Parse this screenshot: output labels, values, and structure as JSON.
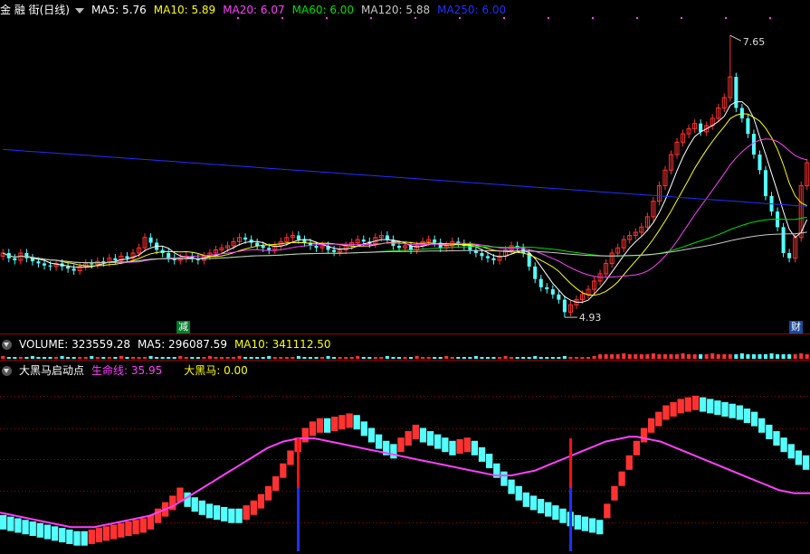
{
  "main_header": {
    "title": "金 融 街(日线)",
    "ma5": "MA5: 5.76",
    "ma10": "MA10: 5.89",
    "ma20": "MA20: 6.07",
    "ma60": "MA60: 6.00",
    "ma120": "MA120: 5.88",
    "ma250": "MA250: 6.00"
  },
  "volume_header": {
    "volume": "VOLUME: 323559.28",
    "ma5": "MA5: 296087.59",
    "ma10": "MA10: 341112.50"
  },
  "indicator_header": {
    "name": "大黑马启动点",
    "line1": "生命线: 35.95",
    "line2": "大黑马: 0.00"
  },
  "colors": {
    "up": "#ff3232",
    "down": "#54ffff",
    "ma5": "#ffffff",
    "ma10": "#ffff00",
    "ma20": "#ff40ff",
    "ma60": "#00e000",
    "ma120": "#c8c8c8",
    "ma250": "#2030ff",
    "life_line": "#ff40ff",
    "grid": "#a00000"
  },
  "marker_labels": {
    "high": "7.65",
    "low": "4.93",
    "tag_jian": "减",
    "tag_cai": "财"
  },
  "chart_data": [
    {
      "type": "candlestick",
      "name": "price",
      "high": 7.65,
      "low": 4.93,
      "ylim": [
        4.8,
        7.8
      ],
      "ma_values": {
        "MA5": 5.76,
        "MA10": 5.89,
        "MA20": 6.07,
        "MA60": 6.0,
        "MA120": 5.88,
        "MA250": 6.0
      },
      "closes": [
        5.55,
        5.5,
        5.48,
        5.55,
        5.5,
        5.47,
        5.45,
        5.43,
        5.42,
        5.45,
        5.42,
        5.4,
        5.38,
        5.42,
        5.45,
        5.44,
        5.47,
        5.46,
        5.5,
        5.48,
        5.52,
        5.5,
        5.55,
        5.6,
        5.7,
        5.65,
        5.58,
        5.55,
        5.5,
        5.48,
        5.5,
        5.52,
        5.5,
        5.48,
        5.52,
        5.55,
        5.58,
        5.6,
        5.62,
        5.66,
        5.7,
        5.68,
        5.65,
        5.62,
        5.6,
        5.58,
        5.62,
        5.66,
        5.7,
        5.72,
        5.68,
        5.65,
        5.62,
        5.6,
        5.62,
        5.58,
        5.56,
        5.58,
        5.62,
        5.65,
        5.68,
        5.66,
        5.64,
        5.7,
        5.72,
        5.68,
        5.62,
        5.6,
        5.62,
        5.58,
        5.62,
        5.66,
        5.68,
        5.65,
        5.6,
        5.62,
        5.66,
        5.64,
        5.62,
        5.58,
        5.55,
        5.52,
        5.5,
        5.48,
        5.52,
        5.58,
        5.62,
        5.6,
        5.55,
        5.42,
        5.3,
        5.22,
        5.2,
        5.15,
        5.1,
        4.98,
        5.05,
        5.1,
        5.15,
        5.2,
        5.28,
        5.35,
        5.45,
        5.55,
        5.6,
        5.68,
        5.72,
        5.75,
        5.8,
        5.9,
        6.05,
        6.2,
        6.35,
        6.5,
        6.62,
        6.7,
        6.75,
        6.8,
        6.72,
        6.78,
        6.85,
        6.95,
        7.05,
        7.25,
        6.95,
        6.85,
        6.7,
        6.5,
        6.35,
        6.1,
        5.95,
        5.8,
        5.55,
        5.5,
        5.7,
        6.2,
        6.42
      ],
      "volume": {
        "VOLUME": 323559.28,
        "MA5": 296087.59,
        "MA10": 341112.5
      }
    },
    {
      "type": "bar",
      "name": "大黑马启动点",
      "series": [
        {
          "name": "生命线",
          "last": 35.95
        },
        {
          "name": "大黑马",
          "last": 0.0
        }
      ],
      "values": [
        18,
        17,
        16,
        15,
        14,
        13,
        12,
        11,
        10,
        9,
        8,
        8,
        9,
        10,
        11,
        12,
        13,
        14,
        15,
        16,
        18,
        22,
        26,
        30,
        35,
        32,
        29,
        27,
        25,
        24,
        23,
        22,
        22,
        24,
        27,
        31,
        36,
        42,
        50,
        58,
        66,
        72,
        76,
        78,
        78,
        79,
        80,
        81,
        80,
        76,
        72,
        68,
        64,
        62,
        66,
        70,
        74,
        72,
        70,
        68,
        66,
        64,
        65,
        66,
        64,
        60,
        56,
        50,
        45,
        40,
        36,
        32,
        30,
        28,
        26,
        24,
        22,
        20,
        18,
        17,
        16,
        15,
        25,
        36,
        45,
        55,
        64,
        72,
        78,
        82,
        86,
        88,
        90,
        91,
        92,
        91,
        90,
        89,
        88,
        87,
        86,
        84,
        82,
        78,
        74,
        70,
        66,
        62,
        58,
        55
      ],
      "life_line": [
        24,
        23,
        22,
        21,
        20,
        19,
        18,
        17,
        16,
        15,
        15,
        15,
        15,
        16,
        17,
        18,
        19,
        20,
        21,
        22,
        24,
        26,
        28,
        31,
        34,
        37,
        40,
        43,
        46,
        49,
        52,
        55,
        58,
        61,
        64,
        66,
        68,
        69,
        70,
        70,
        70,
        69,
        68,
        67,
        66,
        65,
        64,
        63,
        62,
        61,
        60,
        59,
        58,
        57,
        56,
        55,
        54,
        53,
        52,
        51,
        50,
        49,
        48,
        47,
        47,
        47,
        48,
        49,
        50,
        52,
        54,
        56,
        58,
        60,
        62,
        64,
        66,
        68,
        69,
        70,
        71,
        71,
        70,
        69,
        68,
        66,
        64,
        62,
        60,
        58,
        56,
        54,
        52,
        50,
        48,
        46,
        44,
        42,
        40,
        38,
        37,
        36,
        36,
        35.95
      ],
      "signal_bars": [
        {
          "category_index": 40,
          "value": 100
        },
        {
          "category_index": 77,
          "value": 100
        }
      ]
    }
  ]
}
